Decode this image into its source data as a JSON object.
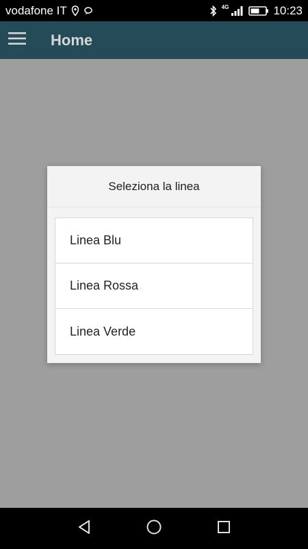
{
  "status_bar": {
    "carrier": "vodafone IT",
    "network_type": "4G",
    "time": "10:23",
    "icons": [
      "location-icon",
      "chat-bubble-icon",
      "bluetooth-icon",
      "signal-icon",
      "battery-icon"
    ]
  },
  "app_bar": {
    "title": "Home",
    "menu_icon": "hamburger-menu-icon",
    "background": "#254b59"
  },
  "dialog": {
    "title": "Seleziona la linea",
    "options": [
      {
        "label": "Linea Blu"
      },
      {
        "label": "Linea Rossa"
      },
      {
        "label": "Linea Verde"
      }
    ]
  },
  "nav_bar": {
    "buttons": [
      "back-icon",
      "home-icon",
      "recents-icon"
    ]
  }
}
